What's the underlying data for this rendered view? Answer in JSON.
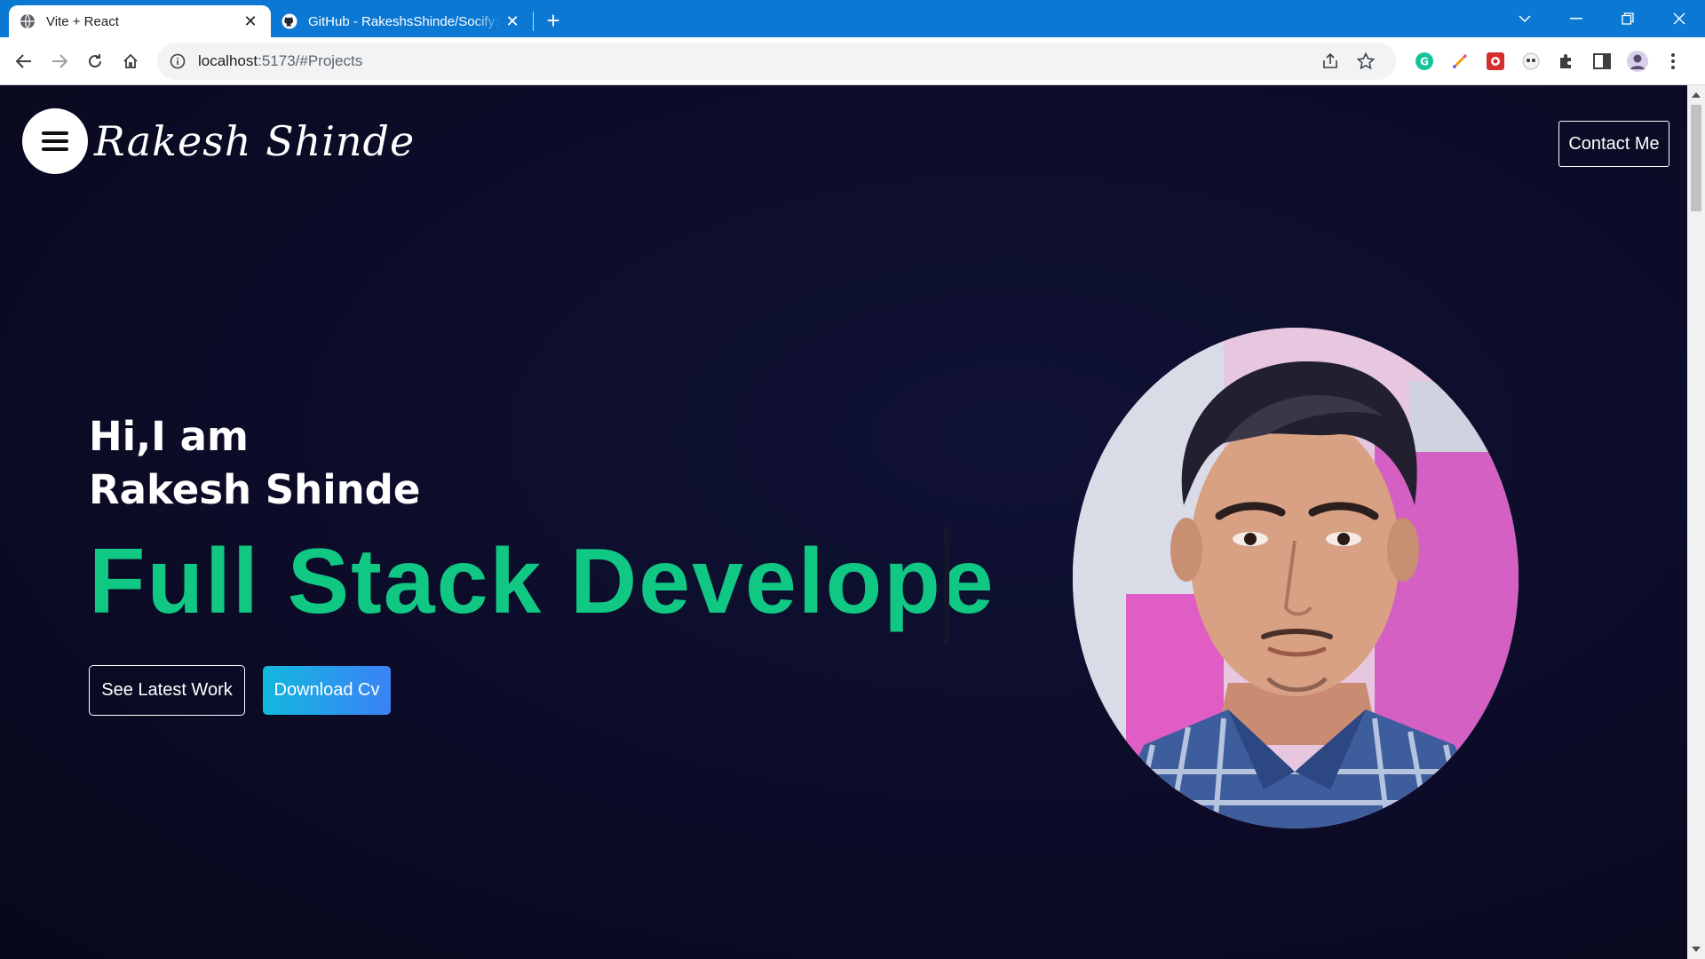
{
  "browser": {
    "tabs": [
      {
        "title": "Vite + React",
        "active": true,
        "icon": "globe-icon"
      },
      {
        "title": "GitHub - RakeshsShinde/Socify:",
        "active": false,
        "icon": "github-icon"
      }
    ],
    "url_host": "localhost",
    "url_path": ":5173/#Projects"
  },
  "page": {
    "logo": "Rakesh Shinde",
    "contact_label": "Contact Me",
    "greeting_line1": "Hi,I am",
    "greeting_line2": "Rakesh Shinde",
    "role_text": "Full Stack Develope",
    "see_work_label": "See Latest Work",
    "download_cv_label": "Download Cv"
  },
  "colors": {
    "accent_green": "#10c783",
    "gradient_start": "#12b8de",
    "gradient_end": "#3b82f6",
    "page_bg": "#0b0b23",
    "tabbar_blue": "#0b78d4"
  }
}
